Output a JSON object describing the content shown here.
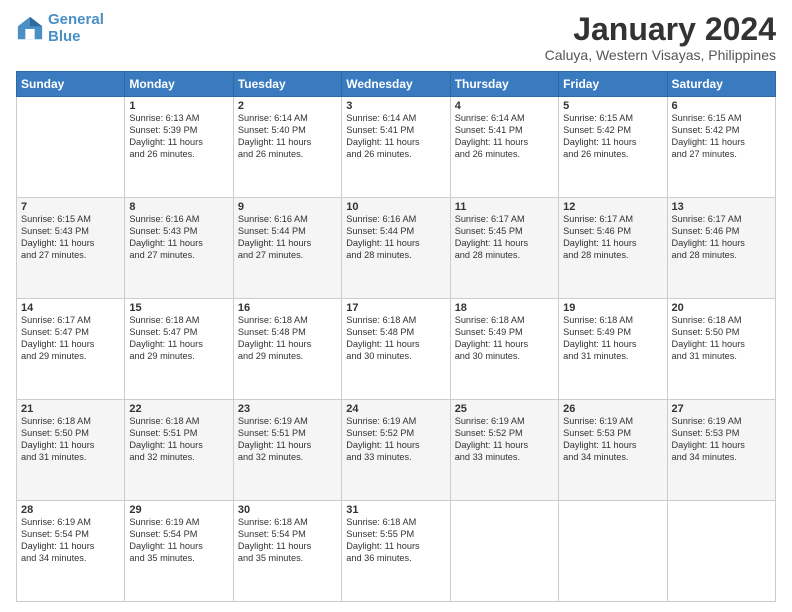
{
  "logo": {
    "line1": "General",
    "line2": "Blue"
  },
  "title": "January 2024",
  "subtitle": "Caluya, Western Visayas, Philippines",
  "days_header": [
    "Sunday",
    "Monday",
    "Tuesday",
    "Wednesday",
    "Thursday",
    "Friday",
    "Saturday"
  ],
  "weeks": [
    [
      {
        "num": "",
        "info": ""
      },
      {
        "num": "1",
        "info": "Sunrise: 6:13 AM\nSunset: 5:39 PM\nDaylight: 11 hours\nand 26 minutes."
      },
      {
        "num": "2",
        "info": "Sunrise: 6:14 AM\nSunset: 5:40 PM\nDaylight: 11 hours\nand 26 minutes."
      },
      {
        "num": "3",
        "info": "Sunrise: 6:14 AM\nSunset: 5:41 PM\nDaylight: 11 hours\nand 26 minutes."
      },
      {
        "num": "4",
        "info": "Sunrise: 6:14 AM\nSunset: 5:41 PM\nDaylight: 11 hours\nand 26 minutes."
      },
      {
        "num": "5",
        "info": "Sunrise: 6:15 AM\nSunset: 5:42 PM\nDaylight: 11 hours\nand 26 minutes."
      },
      {
        "num": "6",
        "info": "Sunrise: 6:15 AM\nSunset: 5:42 PM\nDaylight: 11 hours\nand 27 minutes."
      }
    ],
    [
      {
        "num": "7",
        "info": "Sunrise: 6:15 AM\nSunset: 5:43 PM\nDaylight: 11 hours\nand 27 minutes."
      },
      {
        "num": "8",
        "info": "Sunrise: 6:16 AM\nSunset: 5:43 PM\nDaylight: 11 hours\nand 27 minutes."
      },
      {
        "num": "9",
        "info": "Sunrise: 6:16 AM\nSunset: 5:44 PM\nDaylight: 11 hours\nand 27 minutes."
      },
      {
        "num": "10",
        "info": "Sunrise: 6:16 AM\nSunset: 5:44 PM\nDaylight: 11 hours\nand 28 minutes."
      },
      {
        "num": "11",
        "info": "Sunrise: 6:17 AM\nSunset: 5:45 PM\nDaylight: 11 hours\nand 28 minutes."
      },
      {
        "num": "12",
        "info": "Sunrise: 6:17 AM\nSunset: 5:46 PM\nDaylight: 11 hours\nand 28 minutes."
      },
      {
        "num": "13",
        "info": "Sunrise: 6:17 AM\nSunset: 5:46 PM\nDaylight: 11 hours\nand 28 minutes."
      }
    ],
    [
      {
        "num": "14",
        "info": "Sunrise: 6:17 AM\nSunset: 5:47 PM\nDaylight: 11 hours\nand 29 minutes."
      },
      {
        "num": "15",
        "info": "Sunrise: 6:18 AM\nSunset: 5:47 PM\nDaylight: 11 hours\nand 29 minutes."
      },
      {
        "num": "16",
        "info": "Sunrise: 6:18 AM\nSunset: 5:48 PM\nDaylight: 11 hours\nand 29 minutes."
      },
      {
        "num": "17",
        "info": "Sunrise: 6:18 AM\nSunset: 5:48 PM\nDaylight: 11 hours\nand 30 minutes."
      },
      {
        "num": "18",
        "info": "Sunrise: 6:18 AM\nSunset: 5:49 PM\nDaylight: 11 hours\nand 30 minutes."
      },
      {
        "num": "19",
        "info": "Sunrise: 6:18 AM\nSunset: 5:49 PM\nDaylight: 11 hours\nand 31 minutes."
      },
      {
        "num": "20",
        "info": "Sunrise: 6:18 AM\nSunset: 5:50 PM\nDaylight: 11 hours\nand 31 minutes."
      }
    ],
    [
      {
        "num": "21",
        "info": "Sunrise: 6:18 AM\nSunset: 5:50 PM\nDaylight: 11 hours\nand 31 minutes."
      },
      {
        "num": "22",
        "info": "Sunrise: 6:18 AM\nSunset: 5:51 PM\nDaylight: 11 hours\nand 32 minutes."
      },
      {
        "num": "23",
        "info": "Sunrise: 6:19 AM\nSunset: 5:51 PM\nDaylight: 11 hours\nand 32 minutes."
      },
      {
        "num": "24",
        "info": "Sunrise: 6:19 AM\nSunset: 5:52 PM\nDaylight: 11 hours\nand 33 minutes."
      },
      {
        "num": "25",
        "info": "Sunrise: 6:19 AM\nSunset: 5:52 PM\nDaylight: 11 hours\nand 33 minutes."
      },
      {
        "num": "26",
        "info": "Sunrise: 6:19 AM\nSunset: 5:53 PM\nDaylight: 11 hours\nand 34 minutes."
      },
      {
        "num": "27",
        "info": "Sunrise: 6:19 AM\nSunset: 5:53 PM\nDaylight: 11 hours\nand 34 minutes."
      }
    ],
    [
      {
        "num": "28",
        "info": "Sunrise: 6:19 AM\nSunset: 5:54 PM\nDaylight: 11 hours\nand 34 minutes."
      },
      {
        "num": "29",
        "info": "Sunrise: 6:19 AM\nSunset: 5:54 PM\nDaylight: 11 hours\nand 35 minutes."
      },
      {
        "num": "30",
        "info": "Sunrise: 6:18 AM\nSunset: 5:54 PM\nDaylight: 11 hours\nand 35 minutes."
      },
      {
        "num": "31",
        "info": "Sunrise: 6:18 AM\nSunset: 5:55 PM\nDaylight: 11 hours\nand 36 minutes."
      },
      {
        "num": "",
        "info": ""
      },
      {
        "num": "",
        "info": ""
      },
      {
        "num": "",
        "info": ""
      }
    ]
  ]
}
